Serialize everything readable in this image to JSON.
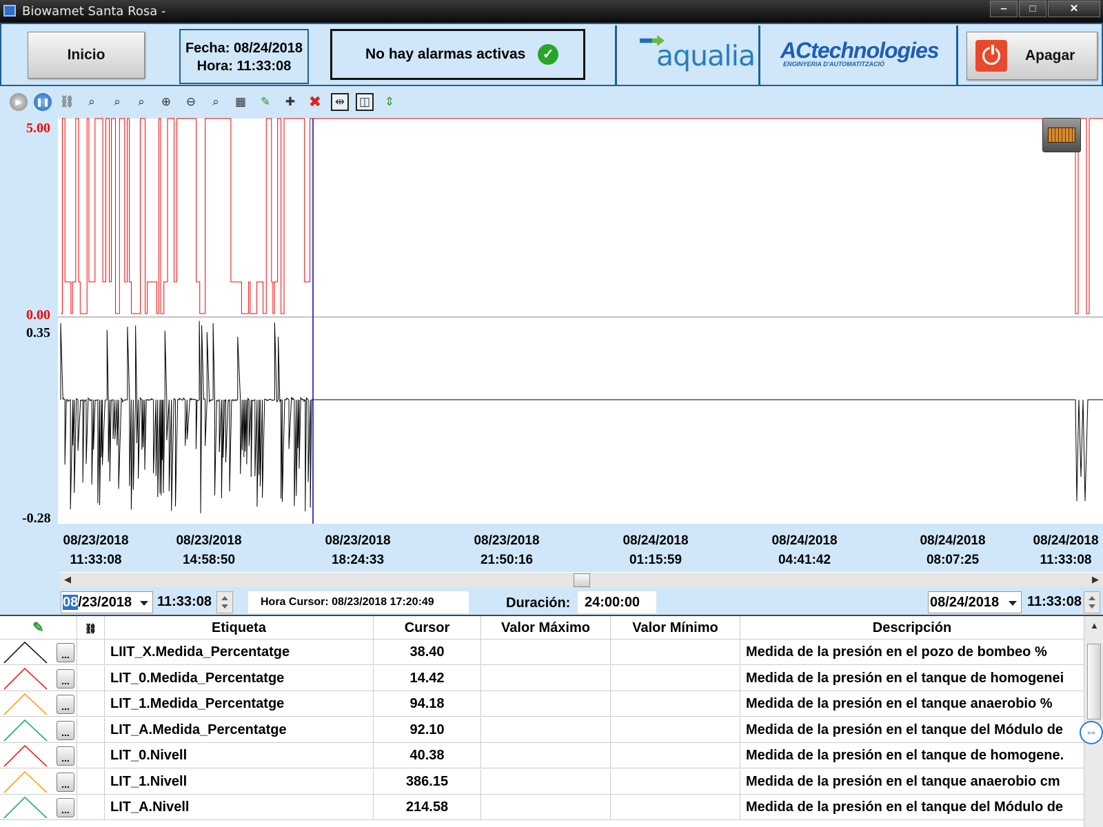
{
  "window": {
    "title": "Biowamet Santa Rosa -",
    "min_glyph": "‒",
    "max_glyph": "□",
    "close_glyph": "✕"
  },
  "header": {
    "inicio_label": "Inicio",
    "fecha_line": "Fecha: 08/24/2018",
    "hora_line": "Hora: 11:33:08",
    "alarm_text": "No hay alarmas activas",
    "alarm_ok_glyph": "✓",
    "logo1_text": "aqualia",
    "logo2_text": "ACtechnologies",
    "logo2_sub": "ENGINYERIA D'AUTOMATITZACIÓ",
    "apagar_label": "Apagar"
  },
  "toolbar": {
    "icons": [
      "play-icon",
      "pause-icon",
      "link-icon",
      "zoom-area-icon",
      "zoom-vertical-icon",
      "zoom-horizontal-icon",
      "zoom-in-icon",
      "zoom-out-icon",
      "zoom-reset-icon",
      "table-icon",
      "pen-icon",
      "add-icon",
      "delete-icon",
      "split-horizontal-icon",
      "split-vertical-icon",
      "expand-vertical-icon"
    ],
    "glyphs": [
      "▶",
      "❚❚",
      "⛓",
      "⌕",
      "⌕",
      "⌕",
      "⊕",
      "⊖",
      "⌕",
      "▦",
      "✎",
      "✚",
      "✖",
      "⇹",
      "◫",
      "⇕"
    ]
  },
  "chart": {
    "colors": {
      "series1": "#ff0000",
      "series2": "#000000",
      "cursor": "#0000cc"
    },
    "upper_axis": {
      "max_label": "5.00",
      "min_label": "0.00"
    },
    "lower_axis": {
      "max_label": "0.35",
      "min_label": "-0.28"
    },
    "time_ticks": [
      {
        "date": "08/23/2018",
        "time": "11:33:08"
      },
      {
        "date": "08/23/2018",
        "time": "14:58:50"
      },
      {
        "date": "08/23/2018",
        "time": "18:24:33"
      },
      {
        "date": "08/23/2018",
        "time": "21:50:16"
      },
      {
        "date": "08/24/2018",
        "time": "01:15:59"
      },
      {
        "date": "08/24/2018",
        "time": "04:41:42"
      },
      {
        "date": "08/24/2018",
        "time": "08:07:25"
      },
      {
        "date": "08/24/2018",
        "time": "11:33:08"
      }
    ]
  },
  "range": {
    "start_date_sel": "08",
    "start_date_rest": "/23/2018",
    "start_time": "11:33:08",
    "cursor_text": "Hora Cursor: 08/23/2018 17:20:49",
    "duration_label": "Duración:",
    "duration_value": "24:00:00",
    "end_date": "08/24/2018",
    "end_time": "11:33:08"
  },
  "table": {
    "headers": {
      "pen": "",
      "link": "",
      "etiqueta": "Etiqueta",
      "cursor": "Cursor",
      "max": "Valor Máximo",
      "min": "Valor Mínimo",
      "desc": "Descripción"
    },
    "rows": [
      {
        "color": "#000000",
        "etiqueta": "LIIT_X.Medida_Percentatge",
        "cursor": "38.40",
        "max": "",
        "min": "",
        "desc": "Medida de la presión en el pozo de bombeo %"
      },
      {
        "color": "#ff0000",
        "etiqueta": "LIT_0.Medida_Percentatge",
        "cursor": "14.42",
        "max": "",
        "min": "",
        "desc": "Medida de la presión en el tanque de homogenei"
      },
      {
        "color": "#ff9900",
        "etiqueta": "LIT_1.Medida_Percentatge",
        "cursor": "94.18",
        "max": "",
        "min": "",
        "desc": "Medida de la presión en el tanque anaerobio %"
      },
      {
        "color": "#00aa44",
        "etiqueta": "LIT_A.Medida_Percentatge",
        "cursor": "92.10",
        "max": "",
        "min": "",
        "desc": "Medida de la presión en el tanque del Módulo de"
      },
      {
        "color": "#ff0000",
        "etiqueta": "LIT_0.Nivell",
        "cursor": "40.38",
        "max": "",
        "min": "",
        "desc": "Medida de la presión en el tanque de homogene."
      },
      {
        "color": "#ff9900",
        "etiqueta": "LIT_1.Nivell",
        "cursor": "386.15",
        "max": "",
        "min": "",
        "desc": "Medida de la presión en el tanque anaerobio cm"
      },
      {
        "color": "#00aa44",
        "etiqueta": "LIT_A.Nivell",
        "cursor": "214.58",
        "max": "",
        "min": "",
        "desc": "Medida de la presión en el tanque del Módulo de"
      }
    ],
    "row_button_glyph": "..."
  }
}
